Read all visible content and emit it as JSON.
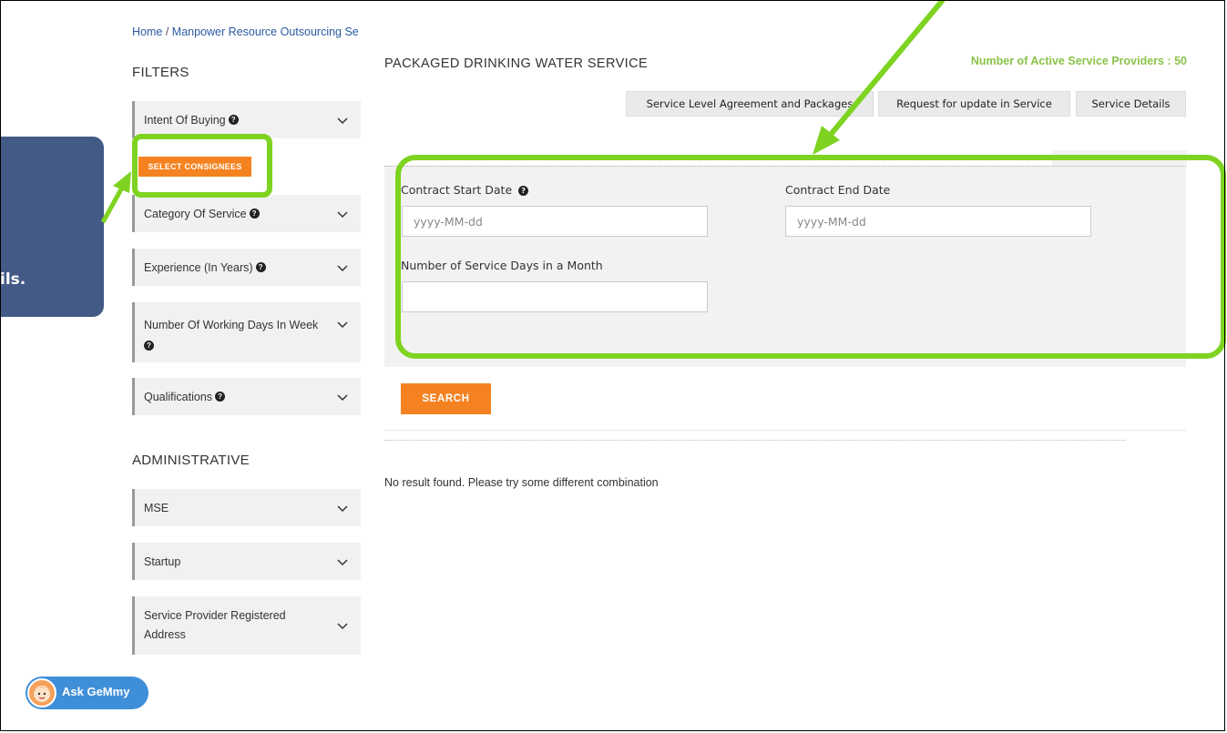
{
  "breadcrumb": {
    "home": "Home",
    "separator": "/",
    "current": "Manpower Resource Outsourcing Se"
  },
  "sidebar": {
    "filters_title": "FILTERS",
    "filters": [
      {
        "label": "Intent Of Buying"
      },
      {
        "label": "Category Of Service"
      },
      {
        "label": "Experience (In Years)"
      },
      {
        "label": "Number Of Working Days In Week"
      },
      {
        "label": "Qualifications"
      }
    ],
    "select_consignees_label": "SELECT CONSIGNEES",
    "administrative_title": "ADMINISTRATIVE",
    "administrative": [
      {
        "label": "MSE"
      },
      {
        "label": "Startup"
      },
      {
        "label": "Service Provider Registered Address"
      }
    ]
  },
  "main": {
    "title": "PACKAGED DRINKING WATER SERVICE",
    "active_providers": "Number of Active Service Providers : 50",
    "buttons": {
      "sla": "Service Level Agreement and Packages",
      "update": "Request for update in Service",
      "details": "Service Details"
    },
    "form": {
      "contract_start_label": "Contract Start Date",
      "contract_start_placeholder": "yyyy-MM-dd",
      "contract_end_label": "Contract End Date",
      "contract_end_placeholder": "yyyy-MM-dd",
      "service_days_label": "Number of Service Days in a Month",
      "service_days_value": ""
    },
    "search_label": "SEARCH",
    "no_result": "No result found. Please try some different combination"
  },
  "overlay": {
    "tooltip_text": "ils.",
    "highlight_color": "#7ed321",
    "tooltip_color": "#435a87"
  },
  "assistant": {
    "label": "Ask GeMmy"
  },
  "colors": {
    "accent_orange": "#f58220",
    "link_blue": "#2a5aa0",
    "providers_green": "#8bc34a",
    "assistant_blue": "#3f8fd8"
  }
}
